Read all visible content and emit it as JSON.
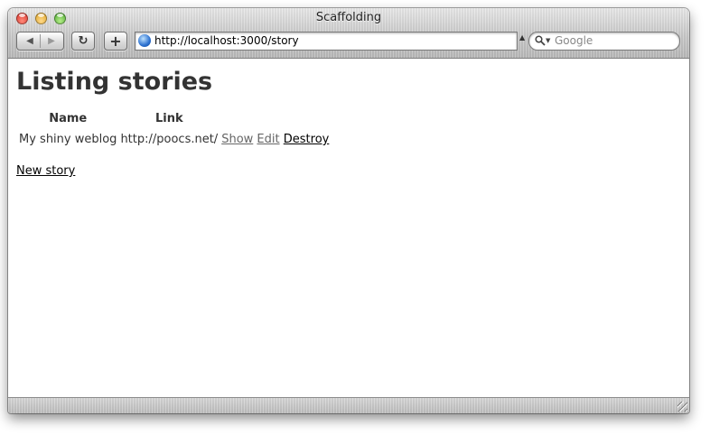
{
  "window": {
    "title": "Scaffolding"
  },
  "toolbar": {
    "back_glyph": "◀",
    "forward_glyph": "▶",
    "reload_glyph": "↻",
    "add_glyph": "+",
    "url": "http://localhost:3000/story",
    "search_placeholder": "Google"
  },
  "page": {
    "heading": "Listing stories",
    "columns": [
      "Name",
      "Link"
    ],
    "rows": [
      {
        "name": "My shiny weblog",
        "link": "http://poocs.net/",
        "actions": [
          "Show",
          "Edit",
          "Destroy"
        ]
      }
    ],
    "new_link": "New story"
  },
  "colors": {
    "text": "#333333",
    "link": "#000000",
    "visited_link": "#666666"
  }
}
